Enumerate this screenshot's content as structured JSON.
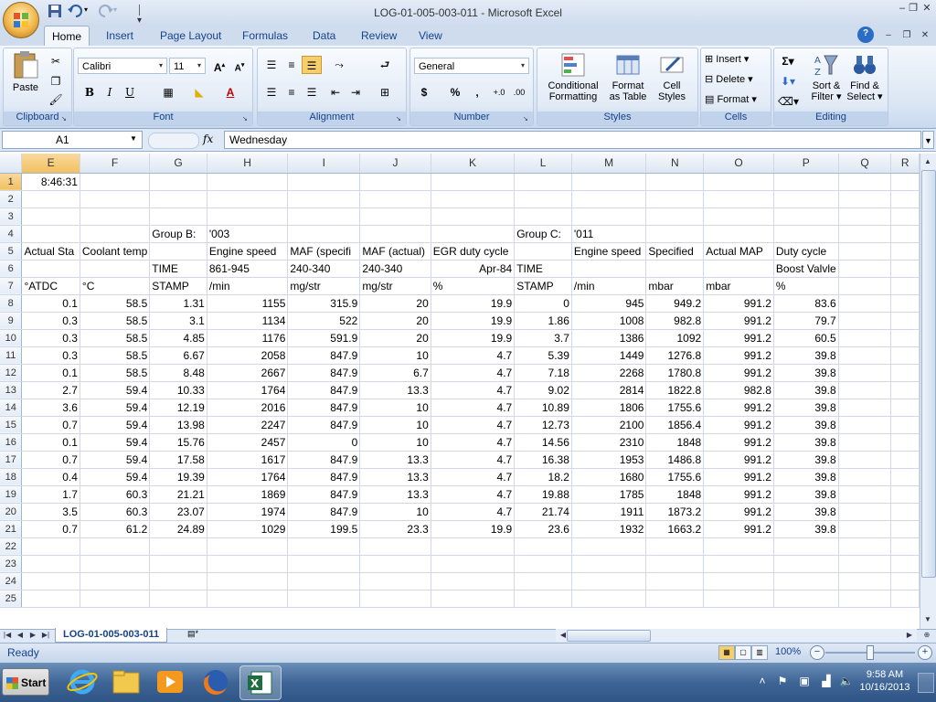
{
  "window": {
    "title": "LOG-01-005-003-011 - Microsoft Excel",
    "qat_separator": "│ ▾"
  },
  "tabs": [
    {
      "label": "Home"
    },
    {
      "label": "Insert"
    },
    {
      "label": "Page Layout"
    },
    {
      "label": "Formulas"
    },
    {
      "label": "Data"
    },
    {
      "label": "Review"
    },
    {
      "label": "View"
    }
  ],
  "ribbon": {
    "clipboard": {
      "label": "Clipboard",
      "paste": "Paste"
    },
    "font": {
      "label": "Font",
      "name": "Calibri",
      "size": "11",
      "bold": "B",
      "italic": "I",
      "underline": "U",
      "grow": "A",
      "shrink": "A"
    },
    "alignment": {
      "label": "Alignment"
    },
    "number": {
      "label": "Number",
      "format": "General",
      "currency": "$",
      "percent": "%",
      "comma": ","
    },
    "styles": {
      "label": "Styles",
      "conditional": "Conditional",
      "conditional2": "Formatting",
      "table": "Format",
      "table2": "as Table",
      "cell": "Cell",
      "cell2": "Styles"
    },
    "cells": {
      "label": "Cells",
      "insert": "Insert",
      "delete": "Delete",
      "format": "Format"
    },
    "editing": {
      "label": "Editing",
      "sort": "Sort &",
      "sort2": "Filter",
      "find": "Find &",
      "find2": "Select"
    }
  },
  "formula_bar": {
    "name_box": "A1",
    "fx": "fx",
    "value": "Wednesday"
  },
  "columns": [
    "E",
    "F",
    "G",
    "H",
    "I",
    "J",
    "K",
    "L",
    "M",
    "N",
    "O",
    "P",
    "Q",
    "R"
  ],
  "rows": [
    {
      "num": "1",
      "cells": [
        "8:46:31",
        "",
        "",
        "",
        "",
        "",
        "",
        "",
        "",
        "",
        "",
        "",
        "",
        ""
      ]
    },
    {
      "num": "2",
      "cells": [
        "",
        "",
        "",
        "",
        "",
        "",
        "",
        "",
        "",
        "",
        "",
        "",
        "",
        ""
      ]
    },
    {
      "num": "3",
      "cells": [
        "",
        "",
        "",
        "",
        "",
        "",
        "",
        "",
        "",
        "",
        "",
        "",
        "",
        ""
      ]
    },
    {
      "num": "4",
      "cells": [
        "",
        "",
        "Group B:",
        "'003",
        "",
        "",
        "",
        "Group C:",
        "'011",
        "",
        "",
        "",
        "",
        ""
      ]
    },
    {
      "num": "5",
      "cells": [
        "Actual Sta",
        "Coolant temp",
        "",
        "Engine speed",
        "MAF (specifi",
        "MAF (actual)",
        "EGR duty cycle",
        "",
        "Engine speed",
        "Specified",
        "Actual MAP",
        "Duty cycle",
        "",
        ""
      ]
    },
    {
      "num": "6",
      "cells": [
        "",
        "",
        "TIME",
        "861-945",
        "240-340",
        "240-340",
        "Apr-84",
        "TIME",
        "",
        "",
        "",
        "Boost Valvle",
        "",
        ""
      ]
    },
    {
      "num": "7",
      "cells": [
        "°ATDC",
        "°C",
        "STAMP",
        "/min",
        "mg/str",
        "mg/str",
        "%",
        "STAMP",
        "/min",
        "mbar",
        "mbar",
        "%",
        "",
        ""
      ]
    },
    {
      "num": "8",
      "cells": [
        "0.1",
        "58.5",
        "1.31",
        "1155",
        "315.9",
        "20",
        "19.9",
        "0",
        "945",
        "949.2",
        "991.2",
        "83.6",
        "",
        ""
      ]
    },
    {
      "num": "9",
      "cells": [
        "0.3",
        "58.5",
        "3.1",
        "1134",
        "522",
        "20",
        "19.9",
        "1.86",
        "1008",
        "982.8",
        "991.2",
        "79.7",
        "",
        ""
      ]
    },
    {
      "num": "10",
      "cells": [
        "0.3",
        "58.5",
        "4.85",
        "1176",
        "591.9",
        "20",
        "19.9",
        "3.7",
        "1386",
        "1092",
        "991.2",
        "60.5",
        "",
        ""
      ]
    },
    {
      "num": "11",
      "cells": [
        "0.3",
        "58.5",
        "6.67",
        "2058",
        "847.9",
        "10",
        "4.7",
        "5.39",
        "1449",
        "1276.8",
        "991.2",
        "39.8",
        "",
        ""
      ]
    },
    {
      "num": "12",
      "cells": [
        "0.1",
        "58.5",
        "8.48",
        "2667",
        "847.9",
        "6.7",
        "4.7",
        "7.18",
        "2268",
        "1780.8",
        "991.2",
        "39.8",
        "",
        ""
      ]
    },
    {
      "num": "13",
      "cells": [
        "2.7",
        "59.4",
        "10.33",
        "1764",
        "847.9",
        "13.3",
        "4.7",
        "9.02",
        "2814",
        "1822.8",
        "982.8",
        "39.8",
        "",
        ""
      ]
    },
    {
      "num": "14",
      "cells": [
        "3.6",
        "59.4",
        "12.19",
        "2016",
        "847.9",
        "10",
        "4.7",
        "10.89",
        "1806",
        "1755.6",
        "991.2",
        "39.8",
        "",
        ""
      ]
    },
    {
      "num": "15",
      "cells": [
        "0.7",
        "59.4",
        "13.98",
        "2247",
        "847.9",
        "10",
        "4.7",
        "12.73",
        "2100",
        "1856.4",
        "991.2",
        "39.8",
        "",
        ""
      ]
    },
    {
      "num": "16",
      "cells": [
        "0.1",
        "59.4",
        "15.76",
        "2457",
        "0",
        "10",
        "4.7",
        "14.56",
        "2310",
        "1848",
        "991.2",
        "39.8",
        "",
        ""
      ]
    },
    {
      "num": "17",
      "cells": [
        "0.7",
        "59.4",
        "17.58",
        "1617",
        "847.9",
        "13.3",
        "4.7",
        "16.38",
        "1953",
        "1486.8",
        "991.2",
        "39.8",
        "",
        ""
      ]
    },
    {
      "num": "18",
      "cells": [
        "0.4",
        "59.4",
        "19.39",
        "1764",
        "847.9",
        "13.3",
        "4.7",
        "18.2",
        "1680",
        "1755.6",
        "991.2",
        "39.8",
        "",
        ""
      ]
    },
    {
      "num": "19",
      "cells": [
        "1.7",
        "60.3",
        "21.21",
        "1869",
        "847.9",
        "13.3",
        "4.7",
        "19.88",
        "1785",
        "1848",
        "991.2",
        "39.8",
        "",
        ""
      ]
    },
    {
      "num": "20",
      "cells": [
        "3.5",
        "60.3",
        "23.07",
        "1974",
        "847.9",
        "10",
        "4.7",
        "21.74",
        "1911",
        "1873.2",
        "991.2",
        "39.8",
        "",
        ""
      ]
    },
    {
      "num": "21",
      "cells": [
        "0.7",
        "61.2",
        "24.89",
        "1029",
        "199.5",
        "23.3",
        "19.9",
        "23.6",
        "1932",
        "1663.2",
        "991.2",
        "39.8",
        "",
        ""
      ]
    },
    {
      "num": "22",
      "cells": [
        "",
        "",
        "",
        "",
        "",
        "",
        "",
        "",
        "",
        "",
        "",
        "",
        "",
        ""
      ]
    },
    {
      "num": "23",
      "cells": [
        "",
        "",
        "",
        "",
        "",
        "",
        "",
        "",
        "",
        "",
        "",
        "",
        "",
        ""
      ]
    },
    {
      "num": "24",
      "cells": [
        "",
        "",
        "",
        "",
        "",
        "",
        "",
        "",
        "",
        "",
        "",
        "",
        "",
        ""
      ]
    },
    {
      "num": "25",
      "cells": [
        "",
        "",
        "",
        "",
        "",
        "",
        "",
        "",
        "",
        "",
        "",
        "",
        "",
        ""
      ]
    }
  ],
  "sheet_tab": "LOG-01-005-003-011",
  "status": {
    "ready": "Ready",
    "zoom": "100%",
    "zoom_fraction": 0.5
  },
  "taskbar": {
    "start": "Start",
    "time": "9:58 AM",
    "date": "10/16/2013"
  },
  "colors": {
    "accent": "#15428b",
    "ribbon": "#dbe6f4",
    "selected_header": "#f1c15f",
    "taskbar": "#3e6596"
  }
}
